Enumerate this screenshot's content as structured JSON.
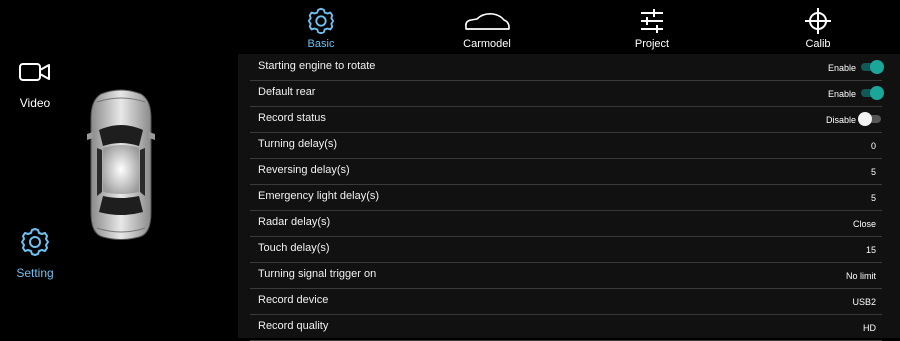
{
  "sidebar": {
    "items": [
      {
        "label": "Video",
        "icon": "video-camera-icon"
      },
      {
        "label": "Setting",
        "icon": "gear-icon"
      }
    ]
  },
  "tabs": [
    {
      "label": "Basic",
      "icon": "gear-icon"
    },
    {
      "label": "Carmodel",
      "icon": "car-outline-icon"
    },
    {
      "label": "Project",
      "icon": "sliders-icon"
    },
    {
      "label": "Calib",
      "icon": "crosshair-icon"
    }
  ],
  "settings": [
    {
      "name": "Starting engine to rotate",
      "value": "Enable",
      "toggle": "on"
    },
    {
      "name": "Default rear",
      "value": "Enable",
      "toggle": "on"
    },
    {
      "name": "Record status",
      "value": "Disable",
      "toggle": "off"
    },
    {
      "name": "Turning delay(s)",
      "value": "0"
    },
    {
      "name": "Reversing delay(s)",
      "value": "5"
    },
    {
      "name": "Emergency light delay(s)",
      "value": "5"
    },
    {
      "name": "Radar delay(s)",
      "value": "Close"
    },
    {
      "name": "Touch delay(s)",
      "value": "15"
    },
    {
      "name": "Turning signal trigger on",
      "value": "No limit"
    },
    {
      "name": "Record device",
      "value": "USB2"
    },
    {
      "name": "Record quality",
      "value": "HD"
    }
  ],
  "colors": {
    "accent": "#6ec0f0",
    "toggle_on": "#1aa79a",
    "background": "#000000",
    "list_background": "#111111"
  }
}
